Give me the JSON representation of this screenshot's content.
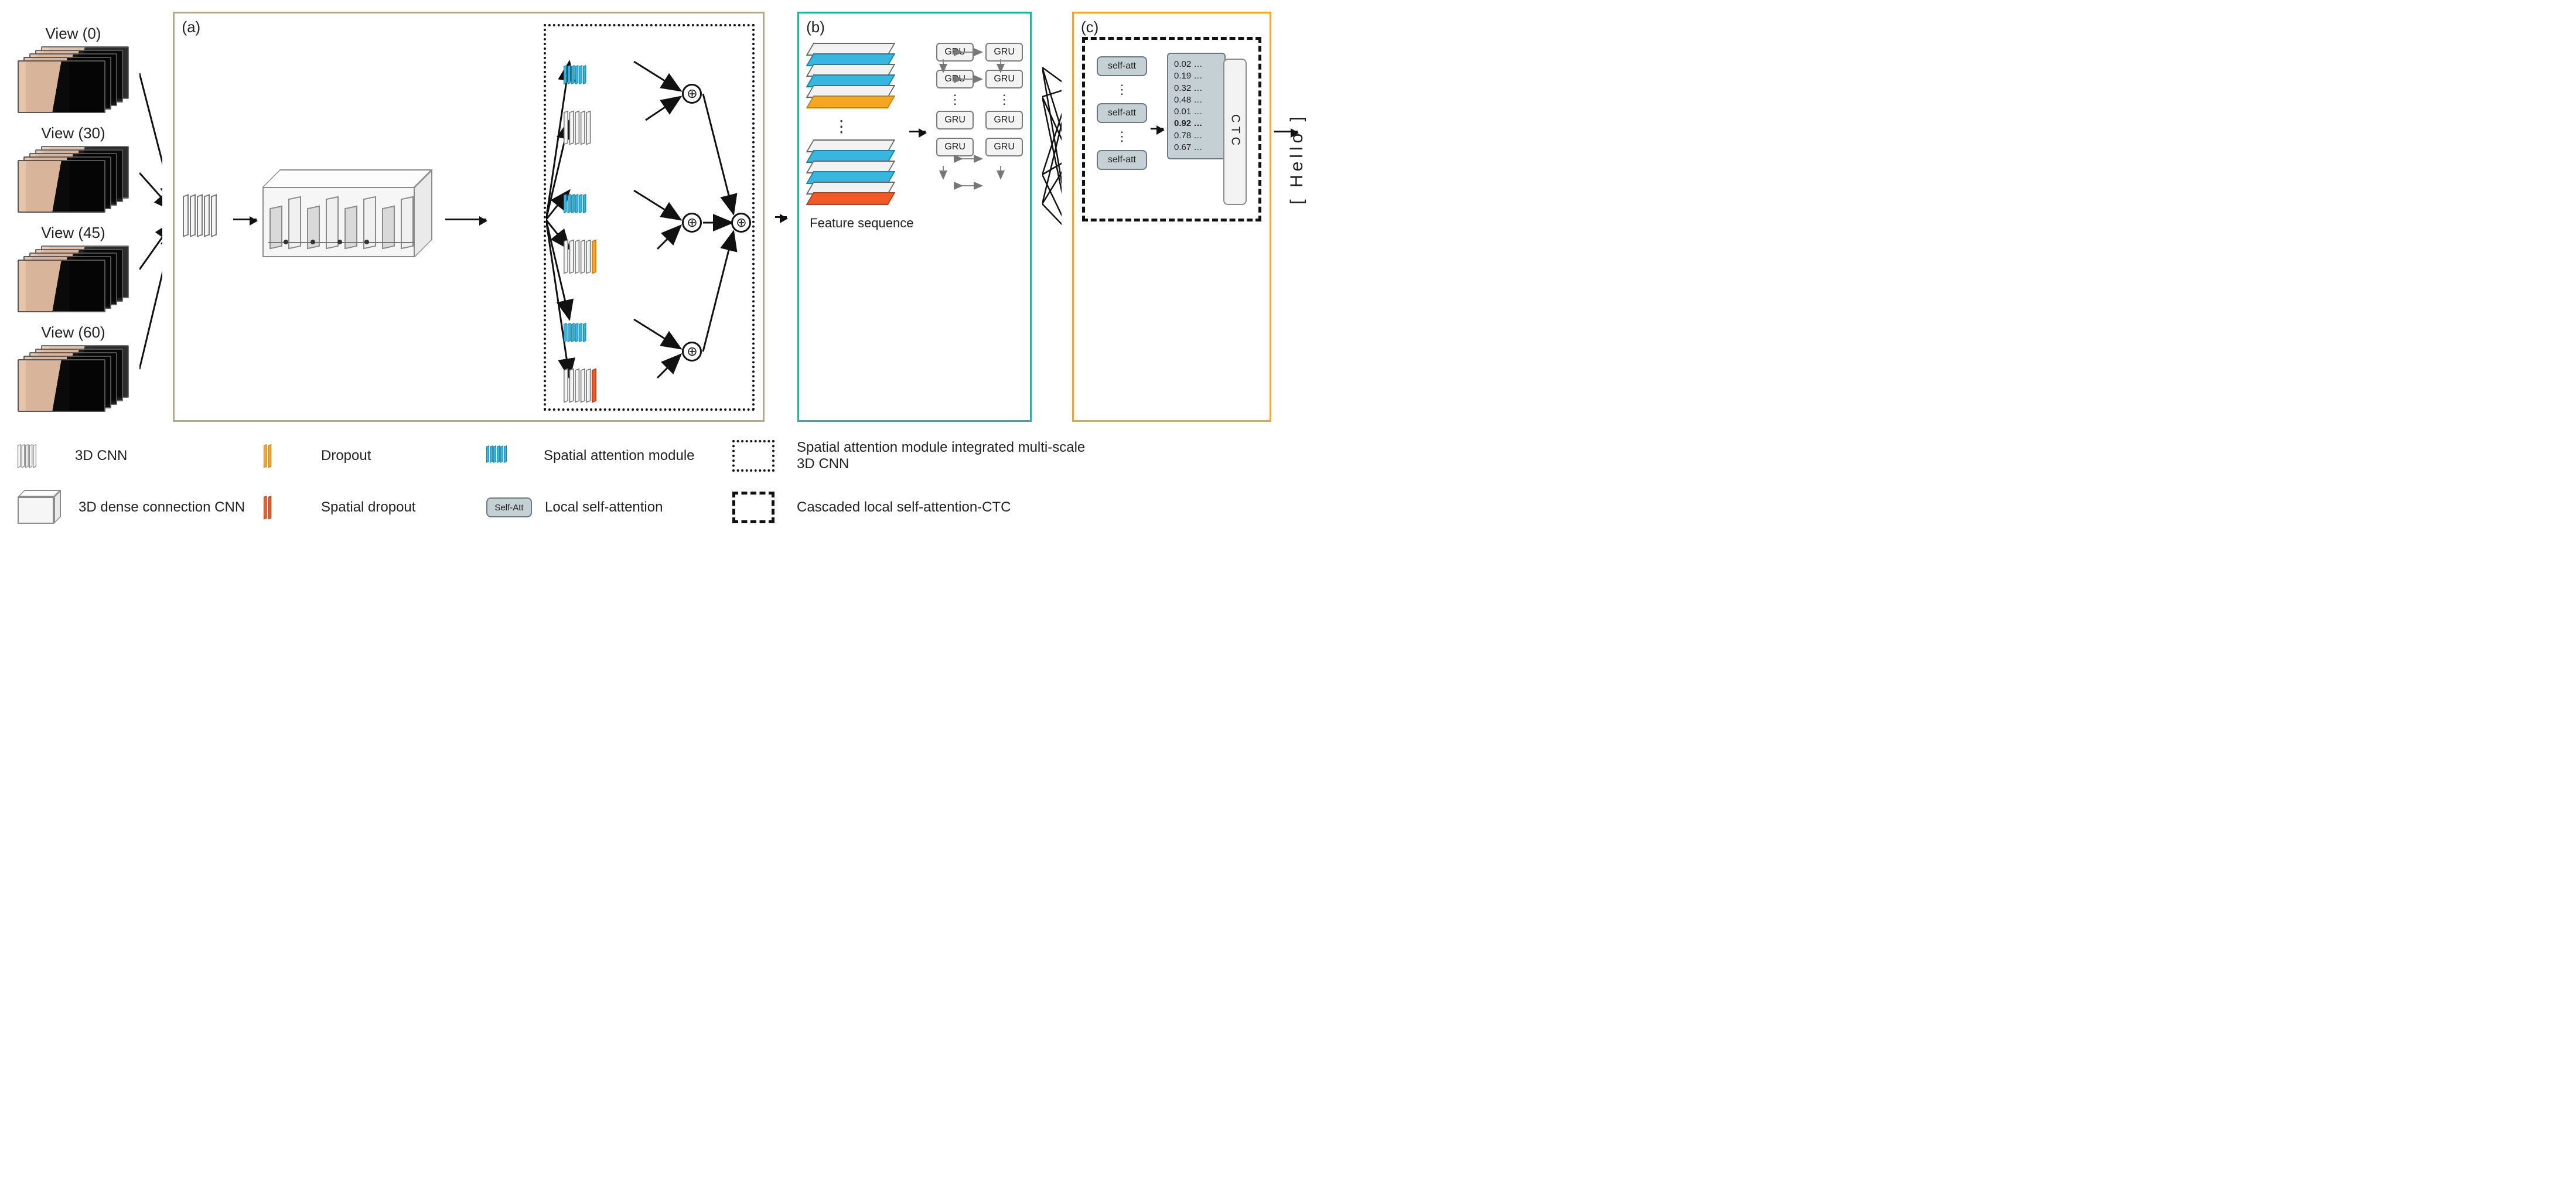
{
  "inputs": {
    "views": [
      "View (0)",
      "View (30)",
      "View (45)",
      "View (60)"
    ]
  },
  "panels": {
    "a": "(a)",
    "b": "(b)",
    "c": "(c)"
  },
  "panel_b": {
    "feature_sequence_label": "Feature sequence",
    "gru_label": "GRU"
  },
  "panel_c": {
    "self_att_label": "self-att",
    "probabilities": [
      "0.02 …",
      "0.19 …",
      "0.32 …",
      "0.48 …",
      "0.01 …",
      "0.92 …",
      "0.78 …",
      "0.67 …"
    ],
    "probability_highlight_index": 5,
    "ctc_label": "CTC",
    "output_text": "[ Hello ]"
  },
  "legend": {
    "items": [
      {
        "key": "3d_cnn",
        "label": "3D CNN"
      },
      {
        "key": "dropout",
        "label": "Dropout"
      },
      {
        "key": "spatial_attention",
        "label": "Spatial attention module"
      },
      {
        "key": "multiscale_box",
        "label": "Spatial attention module integrated multi-scale 3D CNN"
      },
      {
        "key": "dense_cnn",
        "label": "3D dense connection CNN"
      },
      {
        "key": "spatial_dropout",
        "label": "Spatial dropout"
      },
      {
        "key": "local_self_attention_badge",
        "label_inside": "Self-Att",
        "label": "Local self-attention"
      },
      {
        "key": "cascaded_box",
        "label": "Cascaded local self-attention-CTC"
      }
    ]
  }
}
